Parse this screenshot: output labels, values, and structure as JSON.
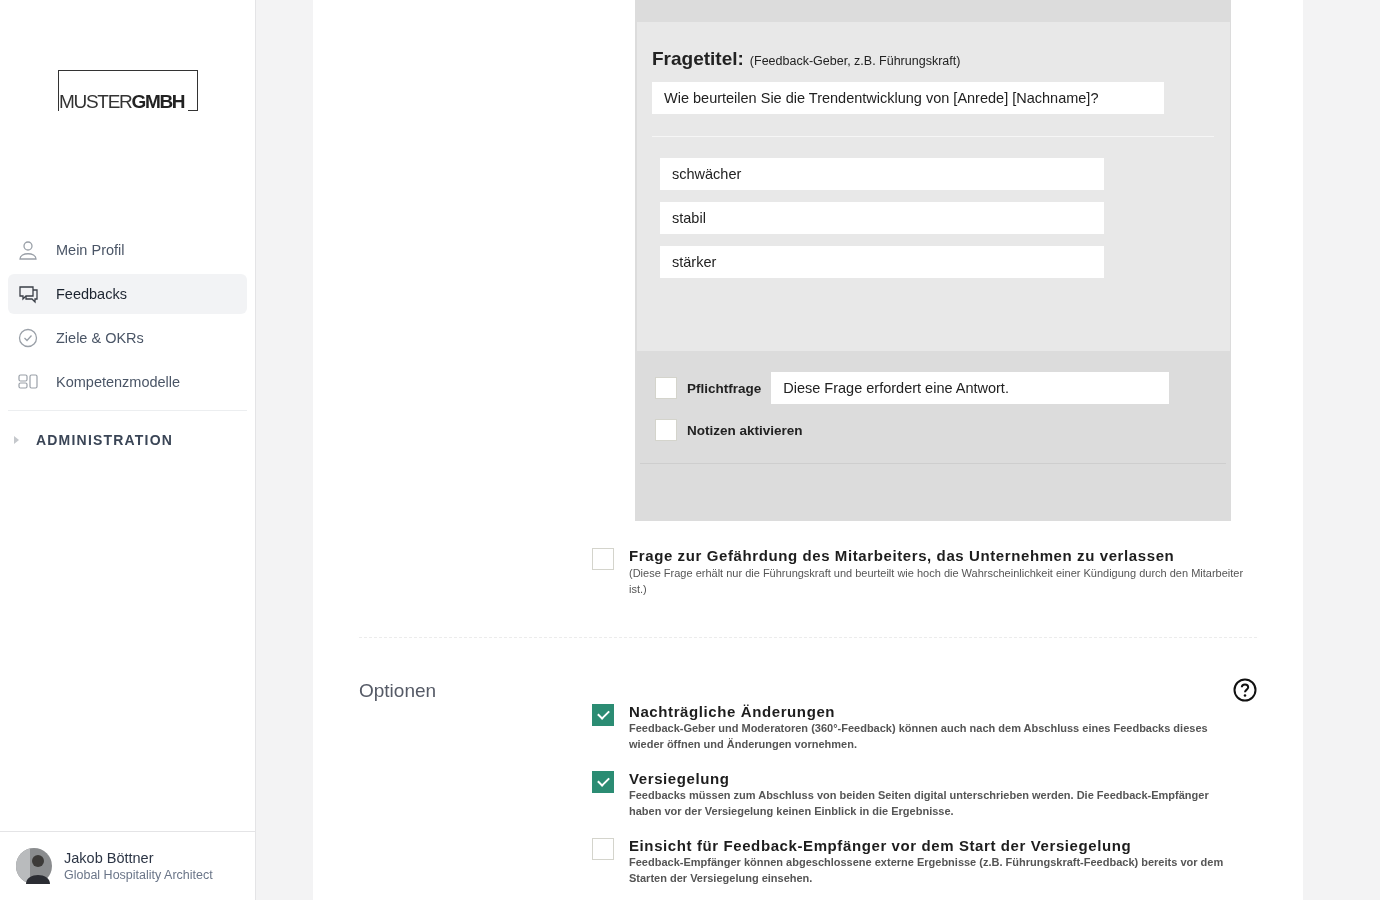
{
  "logo": {
    "light": "MUSTER",
    "bold": "GMBH"
  },
  "sidebar": {
    "items": [
      {
        "kind": "person",
        "label": "Mein Profil",
        "selected": false
      },
      {
        "kind": "chat",
        "label": "Feedbacks",
        "selected": true
      },
      {
        "kind": "check",
        "label": "Ziele & OKRs",
        "selected": false
      },
      {
        "kind": "blocks",
        "label": "Kompetenzmodelle",
        "selected": false
      }
    ],
    "section": {
      "label": "ADMINISTRATION",
      "expanded": false
    }
  },
  "user": {
    "name": "Jakob Böttner",
    "role": "Global Hospitality Architect"
  },
  "question_card": {
    "title_label": "Fragetitel:",
    "title_hint": "(Feedback-Geber, z.B. Führungskraft)",
    "title_value": "Wie beurteilen Sie die Trendentwicklung von [Anrede] [Nachname]?",
    "answers": [
      "schwächer",
      "stabil",
      "stärker"
    ],
    "required": {
      "label": "Pflichtfrage",
      "checked": false,
      "message": "Diese Frage erfordert eine Antwort."
    },
    "notes": {
      "label": "Notizen aktivieren",
      "checked": false
    }
  },
  "risk_question": {
    "checked": false,
    "title": "Frage zur Gefährdung des Mitarbeiters, das Unternehmen zu verlassen",
    "description": "(Diese Frage erhält nur die Führungskraft und beurteilt wie hoch die Wahrscheinlichkeit einer Kündigung durch den Mitarbeiter ist.)"
  },
  "options": {
    "heading": "Optionen",
    "items": [
      {
        "checked": true,
        "title": "Nachträgliche Änderungen",
        "description": "Feedback-Geber und Moderatoren (360°-Feedback) können auch nach dem Abschluss eines Feedbacks dieses wieder öffnen und Änderungen vornehmen."
      },
      {
        "checked": true,
        "title": "Versiegelung",
        "description": "Feedbacks müssen zum Abschluss von beiden Seiten digital unterschrieben werden. Die Feedback-Empfänger haben vor der Versiegelung keinen Einblick in die Ergebnisse."
      },
      {
        "checked": false,
        "title": "Einsicht für Feedback-Empfänger vor dem Start der Versiegelung",
        "description": "Feedback-Empfänger können abgeschlossene externe Ergebnisse (z.B. Führungskraft-Feedback) bereits vor dem Starten der Versiegelung einsehen."
      }
    ]
  }
}
